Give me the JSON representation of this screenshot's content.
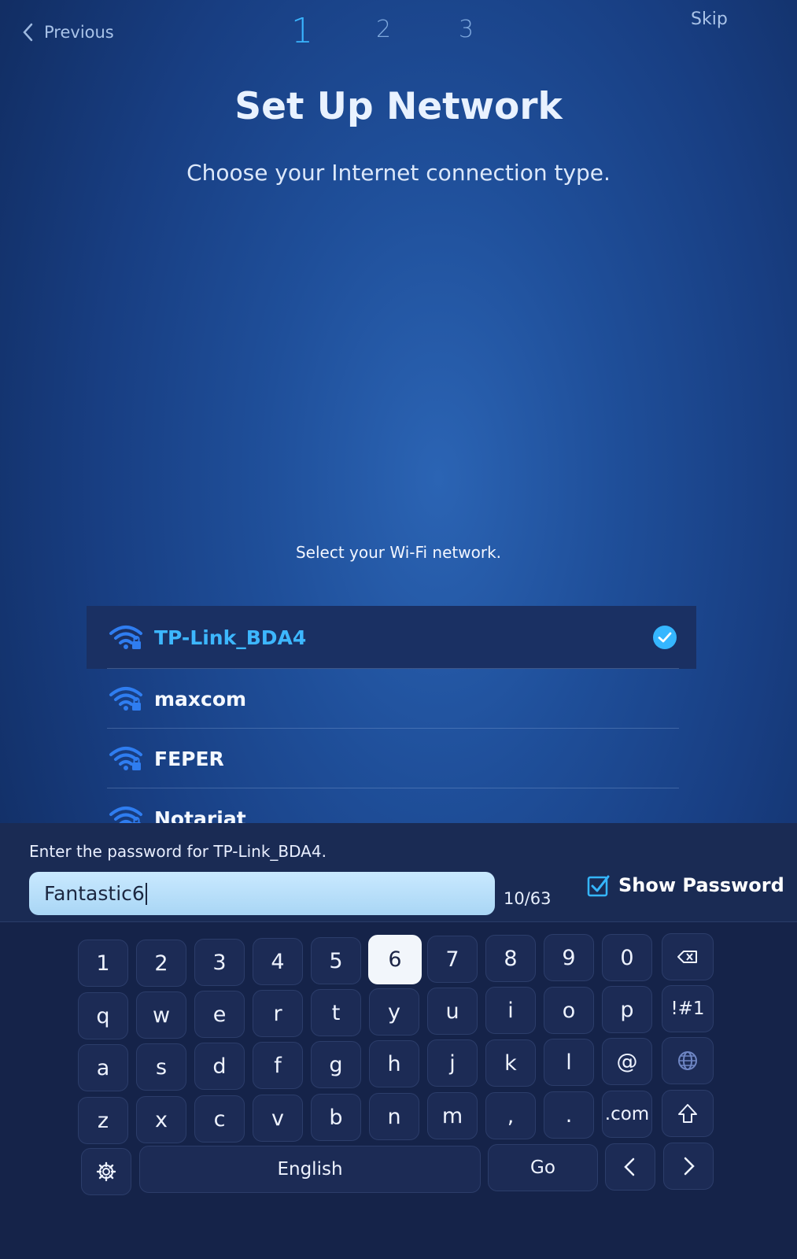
{
  "topbar": {
    "previous": "Previous",
    "steps": [
      "1",
      "2",
      "3"
    ],
    "active_step": "1",
    "skip": "Skip"
  },
  "title": "Set Up Network",
  "subtitle": "Choose your Internet connection type.",
  "wifi": {
    "heading": "Select your Wi-Fi network.",
    "networks": [
      {
        "name": "TP-Link_BDA4",
        "selected": true,
        "secured": true
      },
      {
        "name": "maxcom",
        "selected": false,
        "secured": true
      },
      {
        "name": "FEPER",
        "selected": false,
        "secured": true
      },
      {
        "name": "Notariat",
        "selected": false,
        "secured": true
      }
    ]
  },
  "password": {
    "label": "Enter the password for TP-Link_BDA4.",
    "value": "Fantastic6",
    "counter": "10/63",
    "show_password_label": "Show Password",
    "show_password_checked": true
  },
  "keyboard": {
    "row1": [
      "1",
      "2",
      "3",
      "4",
      "5",
      "6",
      "7",
      "8",
      "9",
      "0"
    ],
    "row2": [
      "q",
      "w",
      "e",
      "r",
      "t",
      "y",
      "u",
      "i",
      "o",
      "p"
    ],
    "row3": [
      "a",
      "s",
      "d",
      "f",
      "g",
      "h",
      "j",
      "k",
      "l",
      "@"
    ],
    "row4": [
      "z",
      "x",
      "c",
      "v",
      "b",
      "n",
      "m",
      ",",
      ".",
      ".com"
    ],
    "symbols_key": "!#1",
    "language_key": "English",
    "go_key": "Go",
    "focused_key": "6",
    "icons": {
      "backspace": "backspace-icon",
      "language": "globe-icon",
      "shift": "shift-icon",
      "settings": "gear-icon",
      "left": "arrow-left-icon",
      "right": "arrow-right-icon"
    }
  },
  "colors": {
    "accent": "#39b5ff",
    "selected_row": "#1a3063",
    "field": "#b8dffa",
    "focus_key": "#f2f6fb"
  }
}
